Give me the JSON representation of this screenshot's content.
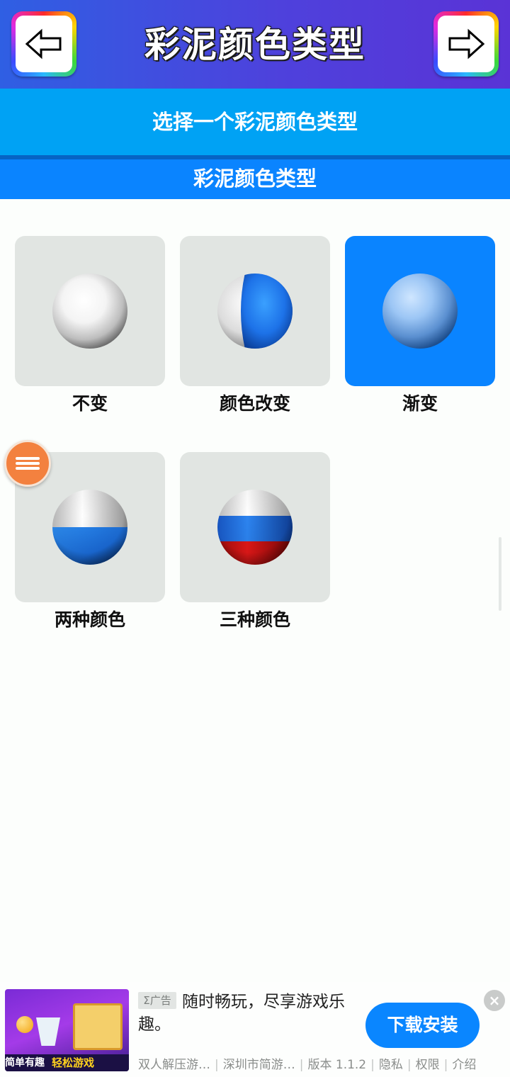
{
  "header": {
    "title": "彩泥颜色类型",
    "back_icon": "left-arrow-icon",
    "next_icon": "right-arrow-icon"
  },
  "subheader": {
    "text": "选择一个彩泥颜色类型"
  },
  "section": {
    "title": "彩泥颜色类型"
  },
  "options": [
    {
      "label": "不变",
      "style": "solid-white",
      "selected": false
    },
    {
      "label": "颜色改变",
      "style": "half-blue",
      "selected": false
    },
    {
      "label": "渐变",
      "style": "gradient-blue",
      "selected": true
    },
    {
      "label": "两种颜色",
      "style": "two-color",
      "selected": false
    },
    {
      "label": "三种颜色",
      "style": "three-color",
      "selected": false
    }
  ],
  "fab": {
    "icon": "menu-icon"
  },
  "ad": {
    "tag": "Σ广告",
    "text": "随时畅玩，尽享游戏乐趣。",
    "thumb_caption_left": "简单有趣",
    "thumb_caption_right": "轻松游戏",
    "meta": [
      "双人解压游…",
      "深圳市简游…",
      "版本 1.1.2",
      "隐私",
      "权限",
      "介绍"
    ],
    "cta": "下载安装",
    "close": "×"
  },
  "colors": {
    "header_start": "#2f5fe3",
    "header_end": "#5a33d6",
    "subheader": "#00a2f4",
    "section": "#0a84ff",
    "tile": "#e1e5e2",
    "tile_selected": "#0a84ff",
    "fab": "#f3813f",
    "cta": "#0a86ff"
  }
}
